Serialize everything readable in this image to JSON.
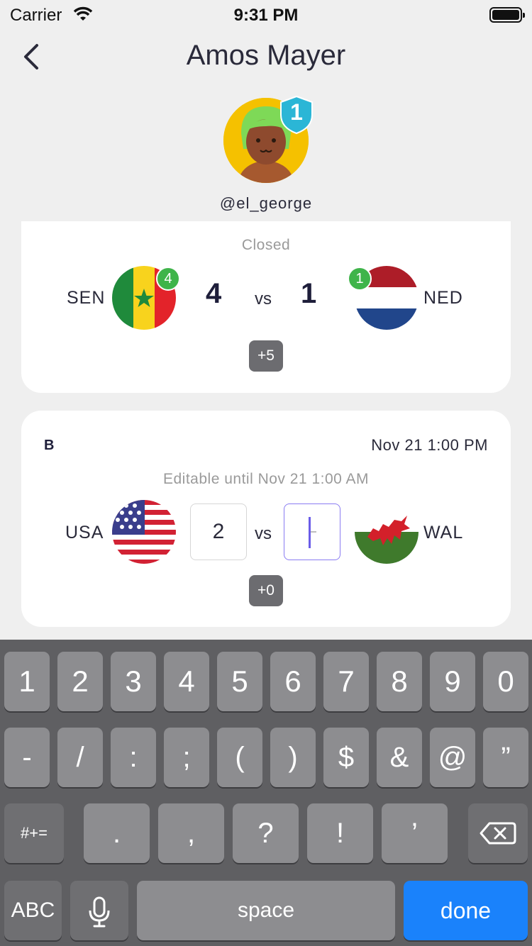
{
  "status": {
    "carrier": "Carrier",
    "time": "9:31 PM"
  },
  "nav": {
    "title": "Amos Mayer"
  },
  "profile": {
    "handle": "@el_george",
    "rank": "1"
  },
  "match1": {
    "state": "Closed",
    "home": {
      "code": "SEN",
      "badge": "4"
    },
    "away": {
      "code": "NED",
      "badge": "1"
    },
    "home_score": "4",
    "away_score": "1",
    "vs": "vs",
    "points": "+5"
  },
  "match2": {
    "group": "B",
    "date": "Nov 21 1:00 PM",
    "state": "Editable until Nov 21 1:00 AM",
    "home": {
      "code": "USA"
    },
    "away": {
      "code": "WAL"
    },
    "home_input": "2",
    "away_input": "",
    "vs": "vs",
    "points": "+0"
  },
  "keyboard": {
    "row1": [
      "1",
      "2",
      "3",
      "4",
      "5",
      "6",
      "7",
      "8",
      "9",
      "0"
    ],
    "row2": [
      "-",
      "/",
      ":",
      ";",
      "(",
      ")",
      "$",
      "&",
      "@",
      "”"
    ],
    "row3": [
      ".",
      ",",
      "?",
      "!",
      "’"
    ],
    "shift_label": "#+=",
    "abc_label": "ABC",
    "space_label": "space",
    "done_label": "done"
  }
}
